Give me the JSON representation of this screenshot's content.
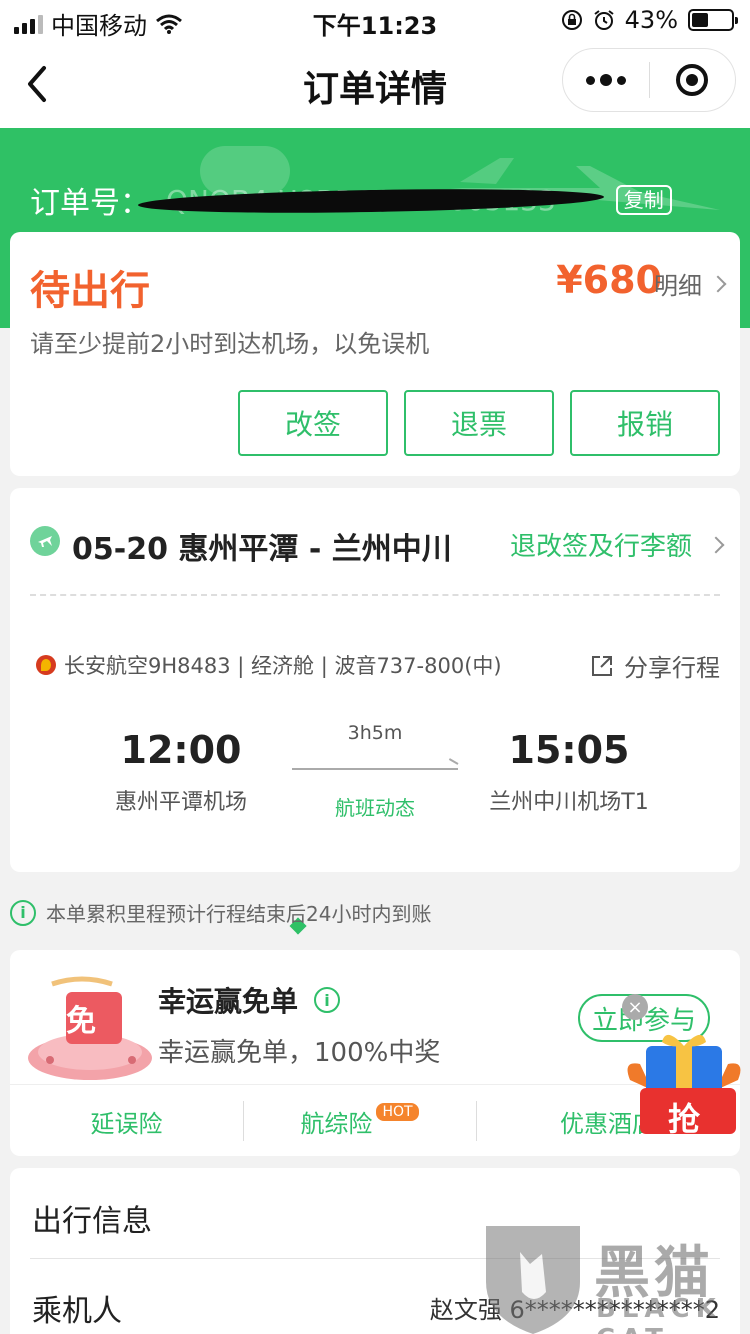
{
  "status_bar": {
    "carrier": "中国移动",
    "time": "下午11:23",
    "battery": "43%",
    "battery_level": 0.43
  },
  "nav": {
    "title": "订单详情"
  },
  "order": {
    "label": "订单号：",
    "number": "QNOB4 H8BD10H57005133",
    "copy_label": "复制"
  },
  "status_card": {
    "status": "待出行",
    "price": "¥680",
    "detail_label": "明细",
    "hint": "请至少提前2小时到达机场，以免误机",
    "buttons": [
      "改签",
      "退票",
      "报销"
    ]
  },
  "flight": {
    "route": "05-20 惠州平潭 - 兰州中川",
    "rules_link": "退改签及行李额",
    "airline_info": "长安航空9H8483 | 经济舱 | 波音737-800(中)",
    "share_label": "分享行程",
    "dep_time": "12:00",
    "dep_airport": "惠州平谭机场",
    "duration": "3h5m",
    "dynamics_link": "航班动态",
    "arr_time": "15:05",
    "arr_airport": "兰州中川机场T1"
  },
  "mileage_note": "本单累积里程预计行程结束后24小时内到账",
  "promo": {
    "title": "幸运赢免单",
    "subtitle": "幸运赢免单，100%中奖",
    "join_label": "立即参与",
    "badge_char": "免",
    "insurance": [
      "延误险",
      "航综险",
      "优惠酒店"
    ],
    "hot_label": "HOT",
    "grab_label": "抢"
  },
  "travel": {
    "title": "出行信息",
    "pax_label": "乘机人",
    "pax_value": "赵文强 6***************2"
  },
  "watermark": {
    "text": "黑猫",
    "sub": "BLACK CAT"
  },
  "colors": {
    "brand_green": "#2fc165",
    "accent_orange": "#f2622e"
  }
}
